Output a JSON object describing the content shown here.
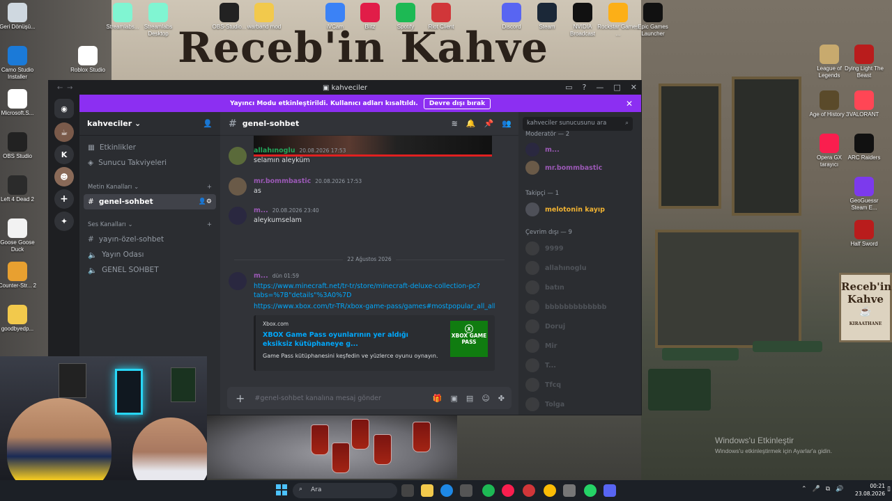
{
  "desktop": {
    "icons_left": [
      {
        "label": "Geri Dönüşü...",
        "icon": "recycle-bin-icon",
        "color": "#cfd8e0"
      },
      {
        "label": "Camo Studio Installer",
        "icon": "download-icon",
        "color": "#1b7ad8"
      },
      {
        "label": "Microsoft.S...",
        "icon": "file-icon",
        "color": "#ffffff"
      },
      {
        "label": "OBS Studio",
        "icon": "obs-icon",
        "color": "#222"
      },
      {
        "label": "Left 4 Dead 2",
        "icon": "l4d2-icon",
        "color": "#2b2b2b"
      },
      {
        "label": "Goose Goose Duck",
        "icon": "goose-icon",
        "color": "#f2f2f2"
      },
      {
        "label": "Counter-Str... 2",
        "icon": "cs2-icon",
        "color": "#e8a030"
      },
      {
        "label": "goodbyedp...",
        "icon": "folder-icon",
        "color": "#f2c94c"
      }
    ],
    "icons_top": [
      {
        "label": "Streamlabs...",
        "icon": "streamlabs-icon",
        "color": "#80f5d2"
      },
      {
        "label": "Streamlabs Desktop",
        "icon": "streamlabs-desktop-icon",
        "color": "#80f5d2"
      },
      {
        "label": "OBS-Studio...",
        "icon": "obs-icon",
        "color": "#222"
      },
      {
        "label": "warband mod",
        "icon": "folder-icon",
        "color": "#f2c94c"
      },
      {
        "label": "Roblox Studio",
        "icon": "roblox-icon",
        "color": "#fff"
      },
      {
        "label": "iVCam",
        "icon": "ivcam-icon",
        "color": "#3b82f6"
      },
      {
        "label": "Blitz",
        "icon": "blitz-icon",
        "color": "#e11d48"
      },
      {
        "label": "Spotify",
        "icon": "spotify-icon",
        "color": "#1db954"
      },
      {
        "label": "Riot Client",
        "icon": "riot-icon",
        "color": "#d13639"
      },
      {
        "label": "Discord",
        "icon": "discord-icon",
        "color": "#5865f2"
      },
      {
        "label": "Steam",
        "icon": "steam-icon",
        "color": "#1b2838"
      },
      {
        "label": "NVIDIA Broadcast",
        "icon": "nvidia-icon",
        "color": "#111"
      },
      {
        "label": "Rockstar Games ...",
        "icon": "rockstar-icon",
        "color": "#fcaf17"
      },
      {
        "label": "Epic Games Launcher",
        "icon": "epic-icon",
        "color": "#111"
      }
    ],
    "icons_right": [
      {
        "label": "League of Legends",
        "icon": "lol-icon",
        "color": "#c8aa6e"
      },
      {
        "label": "Dying Light The Beast",
        "icon": "dying-light-icon",
        "color": "#b91c1c"
      },
      {
        "label": "Age of History 3",
        "icon": "aoh3-icon",
        "color": "#5a4a2a"
      },
      {
        "label": "VALORANT",
        "icon": "valorant-icon",
        "color": "#ff4655"
      },
      {
        "label": "Opera GX tarayıcı",
        "icon": "opera-gx-icon",
        "color": "#fa1e4e"
      },
      {
        "label": "ARC Raiders",
        "icon": "arc-raiders-icon",
        "color": "#111"
      },
      {
        "label": "GeoGuessr Steam E...",
        "icon": "geoguessr-icon",
        "color": "#7c3aed"
      },
      {
        "label": "Half Sword",
        "icon": "half-sword-icon",
        "color": "#b91c1c"
      }
    ],
    "sign_text": "Receb'in Kahve",
    "cafe_sign": [
      "Receb'in",
      "Kahve",
      "KIRAATHANE"
    ]
  },
  "window": {
    "title": "kahveciler",
    "streamer_banner": {
      "text": "Yayıncı Modu etkinleştirildi. Kullanıcı adları kısaltıldı.",
      "button": "Devre dışı bırak"
    }
  },
  "rail": {
    "letter": "K"
  },
  "server": {
    "name": "kahveciler",
    "top_items": [
      {
        "label": "Etkinlikler",
        "icon": "calendar-icon"
      },
      {
        "label": "Sunucu Takviyeleri",
        "icon": "boost-icon"
      }
    ],
    "text_category": "Metin Kanalları",
    "text_channels": [
      {
        "label": "genel-sohbet",
        "selected": true
      }
    ],
    "voice_category": "Ses Kanalları",
    "voice_channels": [
      {
        "label": "yayın-özel-sohbet",
        "icon": "hash-icon"
      },
      {
        "label": "Yayın Odası",
        "icon": "speaker-icon"
      },
      {
        "label": "GENEL SOHBET",
        "icon": "speaker-icon"
      }
    ]
  },
  "channel": {
    "name": "genel-sohbet",
    "messages": [
      {
        "user": "allahınoglu",
        "color": "#23a55a",
        "time": "20.08.2026 17:53",
        "text": "selamın aleyküm"
      },
      {
        "user": "mr.bommbastic",
        "color": "#9b59b6",
        "time": "20.08.2026 17:53",
        "text": "as"
      },
      {
        "user": "m...",
        "color": "#9b59b6",
        "time": "20.08.2026 23:40",
        "text": "aleykumselam"
      }
    ],
    "date_divider": "22 Ağustos 2026",
    "link_message": {
      "user": "m...",
      "color": "#9b59b6",
      "time": "dün 01:59",
      "links": [
        "https://www.minecraft.net/tr-tr/store/minecraft-deluxe-collection-pc?tabs=%7B\"details\"%3A0%7D",
        "https://www.xbox.com/tr-TR/xbox-game-pass/games#mostpopular_all_all_"
      ],
      "embed": {
        "provider": "Xbox.com",
        "title": "XBOX Game Pass oyunlarının yer aldığı eksiksiz kütüphaneye g...",
        "description": "Game Pass kütüphanesini keşfedin ve yüzlerce oyunu oynayın.",
        "thumb": "XBOX GAME PASS"
      }
    },
    "composer_placeholder": "#genel-sohbet kanalına mesaj gönder"
  },
  "members": {
    "search_placeholder": "kahveciler sunucusunu ara",
    "moderator_group": "Moderatör — 2",
    "moderators": [
      {
        "name": "m...",
        "color": "#9b59b6"
      },
      {
        "name": "mr.bommbastic",
        "color": "#9b59b6"
      }
    ],
    "follower_group": "Takipçi — 1",
    "followers": [
      {
        "name": "melotonin kayıp",
        "color": "#f0b232"
      }
    ],
    "offline_group": "Çevrim dışı — 9",
    "offline": [
      "9999",
      "allahınoglu",
      "batın",
      "bbbbbbbbbbbbb",
      "Doruj",
      "Mir",
      "T...",
      "Tfcq",
      "Tolga"
    ]
  },
  "taskbar": {
    "search": "Ara",
    "time": "00:21",
    "date": "23.08.2026"
  },
  "watermark": {
    "title": "Windows'u Etkinleştir",
    "subtitle": "Windows'u etkinleştirmek için Ayarlar'a gidin."
  }
}
